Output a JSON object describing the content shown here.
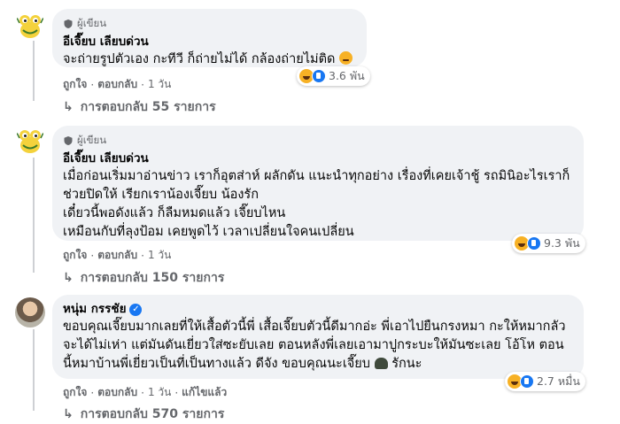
{
  "comments": [
    {
      "badge": "ผู้เขียน",
      "author": "อีเจี๊ยบ เลียบด่วน",
      "text": "จะถ่ายรูปตัวเอง กะทีวี ก็ถ่ายไม่ได้ กล้องถ่ายไม่ติด",
      "reaction_count": "3.6 พัน",
      "actions": [
        "ถูกใจ",
        "ตอบกลับ",
        "1 วัน"
      ],
      "replies": "การตอบกลับ 55 รายการ"
    },
    {
      "badge": "ผู้เขียน",
      "author": "อีเจี๊ยบ เลียบด่วน",
      "text": "เมื่อก่อนเริ่มมาอ่านข่าว เราก็อุตส่าห์ ผลักดัน แนะนำทุกอย่าง เรื่องที่เคยเจ้าชู้ รถมินิอะไรเราก็\nช่วยปิดให้ เรียกเราน้องเจี๊ยบ น้องรัก\nเดี๋ยวนี้พอดังแล้ว ก็ลืมหมดแล้ว เจี๊ยบไหน\nเหมือนกับที่ลุงป้อม เคยพูดไว้ เวลาเปลี่ยนใจคนเปลี่ยน",
      "reaction_count": "9.3 พัน",
      "actions": [
        "ถูกใจ",
        "ตอบกลับ",
        "1 วัน"
      ],
      "replies": "การตอบกลับ 150 รายการ"
    },
    {
      "author": "หนุ่ม กรรชัย",
      "text": "ขอบคุณเจี๊ยบมากเลยที่ให้เสื้อตัวนี้พี่ เสื้อเจี๊ยบตัวนี้ดีมากอ่ะ พี่เอาไปยืนกรงหมา กะให้หมากลัว\nจะได้ไม่เห่า แต่มันดันเยี่ยวใส่ซะยับเลย ตอนหลังพี่เลยเอามาปูกระบะให้มันซะเลย โอ้โห ตอน\nนี้หมาบ้านพี่เยี่ยวเป็นที่เป็นทางแล้ว ดีจัง ขอบคุณนะเจี๊ยบ",
      "text_suffix": "รักนะ",
      "reaction_count": "2.7 หมื่น",
      "actions": [
        "ถูกใจ",
        "ตอบกลับ",
        "1 วัน",
        "แก้ไขแล้ว"
      ],
      "replies": "การตอบกลับ 570 รายการ"
    }
  ],
  "colors": {
    "bubble": "#f0f2f5",
    "secondary_text": "#65676b",
    "verified": "#1877f2",
    "haha": "#f7b125"
  },
  "icons": [
    "frog-avatar-icon",
    "shield-badge-icon",
    "haha-reaction-icon",
    "like-reaction-icon",
    "reply-arrow-icon",
    "verified-icon",
    "sad-emoji-icon",
    "ninja-emoji-icon"
  ]
}
